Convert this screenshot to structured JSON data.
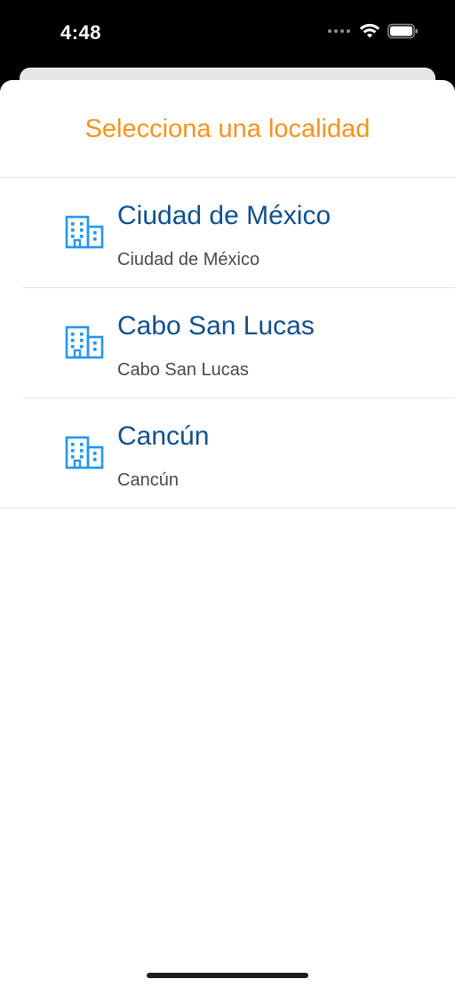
{
  "status_bar": {
    "time": "4:48"
  },
  "sheet": {
    "title": "Selecciona una localidad"
  },
  "locations": [
    {
      "title": "Ciudad de México",
      "subtitle": "Ciudad de México",
      "icon": "building-icon"
    },
    {
      "title": "Cabo San Lucas",
      "subtitle": "Cabo San Lucas",
      "icon": "building-icon"
    },
    {
      "title": "Cancún",
      "subtitle": "Cancún",
      "icon": "building-icon"
    }
  ],
  "colors": {
    "title_accent": "#f7921e",
    "item_title": "#11508c",
    "icon": "#2196f3",
    "subtitle": "#4a4a4d"
  }
}
